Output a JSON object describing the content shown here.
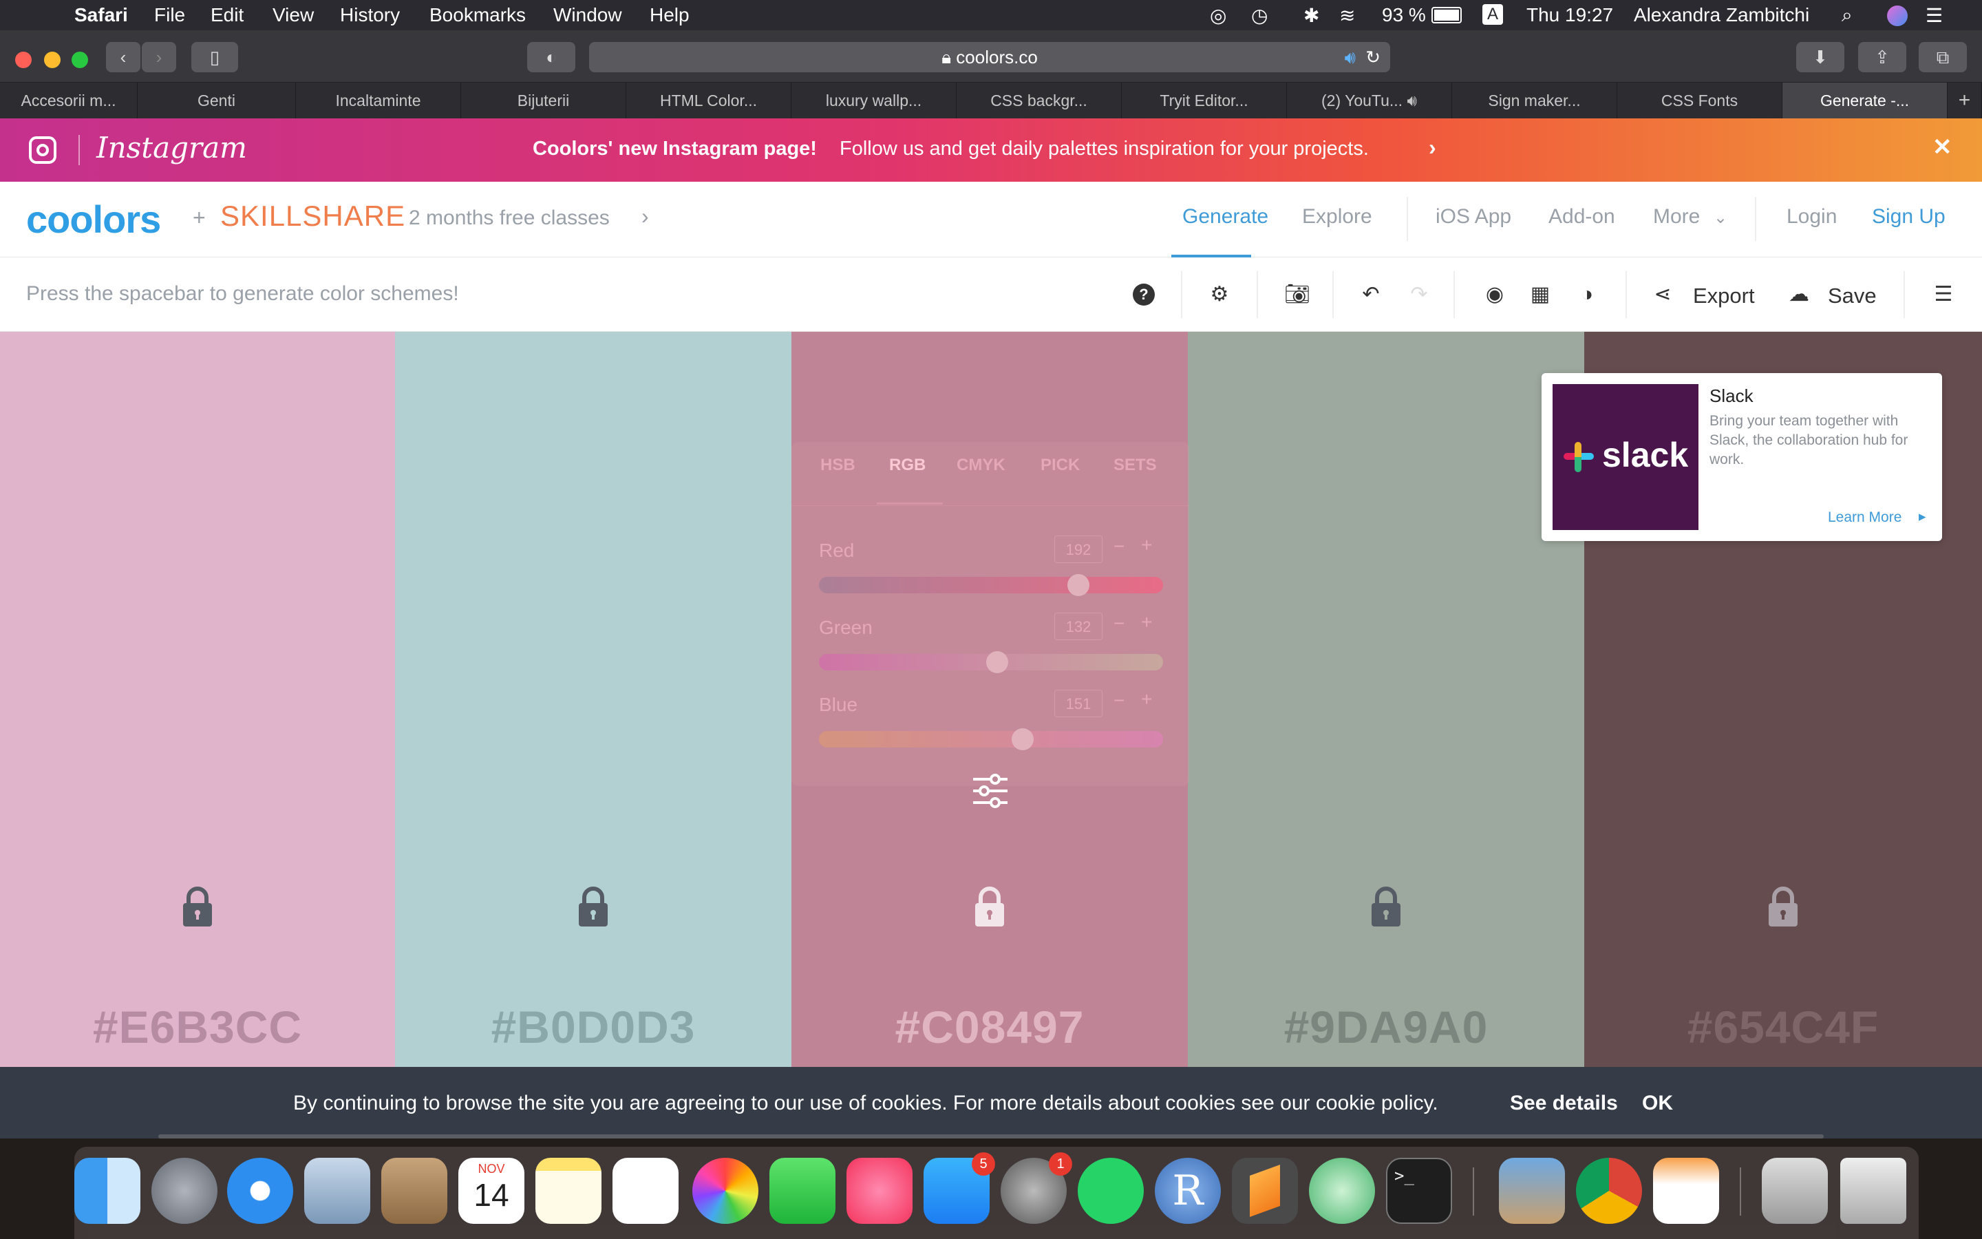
{
  "menubar": {
    "app": "Safari",
    "items": [
      "File",
      "Edit",
      "View",
      "History",
      "Bookmarks",
      "Window",
      "Help"
    ],
    "battery": "93 %",
    "input_source": "A",
    "clock": "Thu 19:27",
    "user": "Alexandra Zambitchi"
  },
  "browser": {
    "url": "coolors.co",
    "tabs": [
      "Accesorii m...",
      "Genti",
      "Incaltaminte",
      "Bijuterii",
      "HTML Color...",
      "luxury wallp...",
      "CSS backgr...",
      "Tryit Editor...",
      "(2) YouTu...",
      "Sign maker...",
      "CSS Fonts",
      "Generate -..."
    ],
    "new_tab": "+"
  },
  "banner": {
    "brand": "Instagram",
    "headline": "Coolors' new Instagram page!",
    "text": "Follow us and get daily palettes inspiration for your projects.",
    "close": "✕"
  },
  "header": {
    "logo": "coolors",
    "plus": "+",
    "partner": "SKILLSHARE",
    "promo": "2 months free classes",
    "nav": {
      "generate": "Generate",
      "explore": "Explore",
      "ios": "iOS App",
      "addon": "Add-on",
      "more": "More",
      "login": "Login",
      "signup": "Sign Up"
    }
  },
  "toolbar": {
    "hint": "Press the spacebar to generate color schemes!",
    "export": "Export",
    "save": "Save"
  },
  "palette": [
    {
      "hex": "#E6B3CC",
      "color": "#e0b4cb",
      "text_color": "#b58ca2"
    },
    {
      "hex": "#B0D0D3",
      "color": "#b2cfd2",
      "text_color": "#8aa7aa"
    },
    {
      "hex": "#C08497",
      "color": "#bf8596",
      "text_color": "#e0b4c0"
    },
    {
      "hex": "#9DA9A0",
      "color": "#9da99f",
      "text_color": "#7b877e"
    },
    {
      "hex": "#654C4F",
      "color": "#654c4f",
      "text_color": "#7d6568"
    }
  ],
  "picker": {
    "tabs": [
      "HSB",
      "RGB",
      "CMYK",
      "PICK",
      "SETS"
    ],
    "active_tab": "RGB",
    "channels": [
      {
        "label": "Red",
        "value": "192",
        "fraction": 0.753
      },
      {
        "label": "Green",
        "value": "132",
        "fraction": 0.518
      },
      {
        "label": "Blue",
        "value": "151",
        "fraction": 0.592
      }
    ]
  },
  "ad": {
    "brand": "slack",
    "title": "Slack",
    "body": "Bring your team together with Slack, the collaboration hub for work.",
    "cta": "Learn More"
  },
  "cookie": {
    "text": "By continuing to browse the site you are agreeing to our use of cookies. For more details about cookies see our cookie policy.",
    "details": "See details",
    "ok": "OK"
  },
  "dock": {
    "calendar_month": "NOV",
    "calendar_day": "14",
    "badge_appstore": "5",
    "badge_prefs": "1",
    "r_letter": "R",
    "terminal_prompt": ">_"
  },
  "colors": {
    "accent": "#3e9bd8",
    "menubar": "#2b2a30"
  }
}
